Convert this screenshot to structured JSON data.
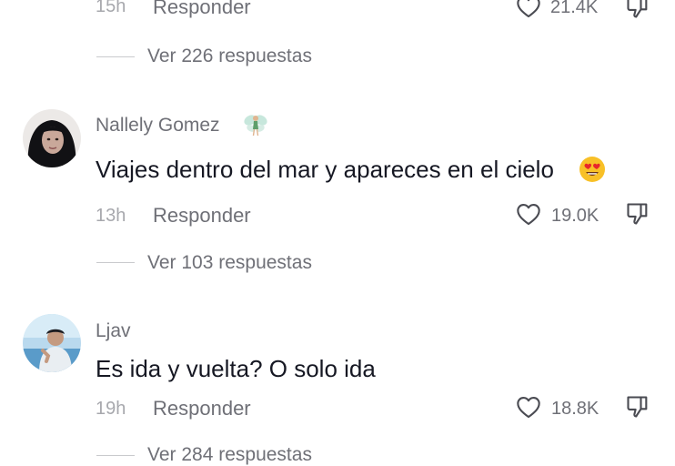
{
  "comments": [
    {
      "username": "",
      "text": "",
      "time": "15h",
      "reply_label": "Responder",
      "likes": "21.4K",
      "view_replies": "Ver 226 respuestas"
    },
    {
      "username": "Nallely Gomez",
      "username_emoji": "fairy",
      "text": "Viajes dentro del mar y apareces en el cielo",
      "text_emoji": "heart-eyes-emoji",
      "time": "13h",
      "reply_label": "Responder",
      "likes": "19.0K",
      "view_replies": "Ver 103 respuestas"
    },
    {
      "username": "Ljav",
      "text": "Es ida y vuelta? O solo ida",
      "time": "19h",
      "reply_label": "Responder",
      "likes": "18.8K",
      "view_replies": "Ver 284 respuestas"
    }
  ],
  "icons": {
    "like": "heart-outline-icon",
    "dislike": "thumbs-down-icon"
  },
  "colors": {
    "text_primary": "#161823",
    "text_secondary": "#6f7077",
    "text_muted": "#a7a8ad",
    "background": "#ffffff"
  }
}
